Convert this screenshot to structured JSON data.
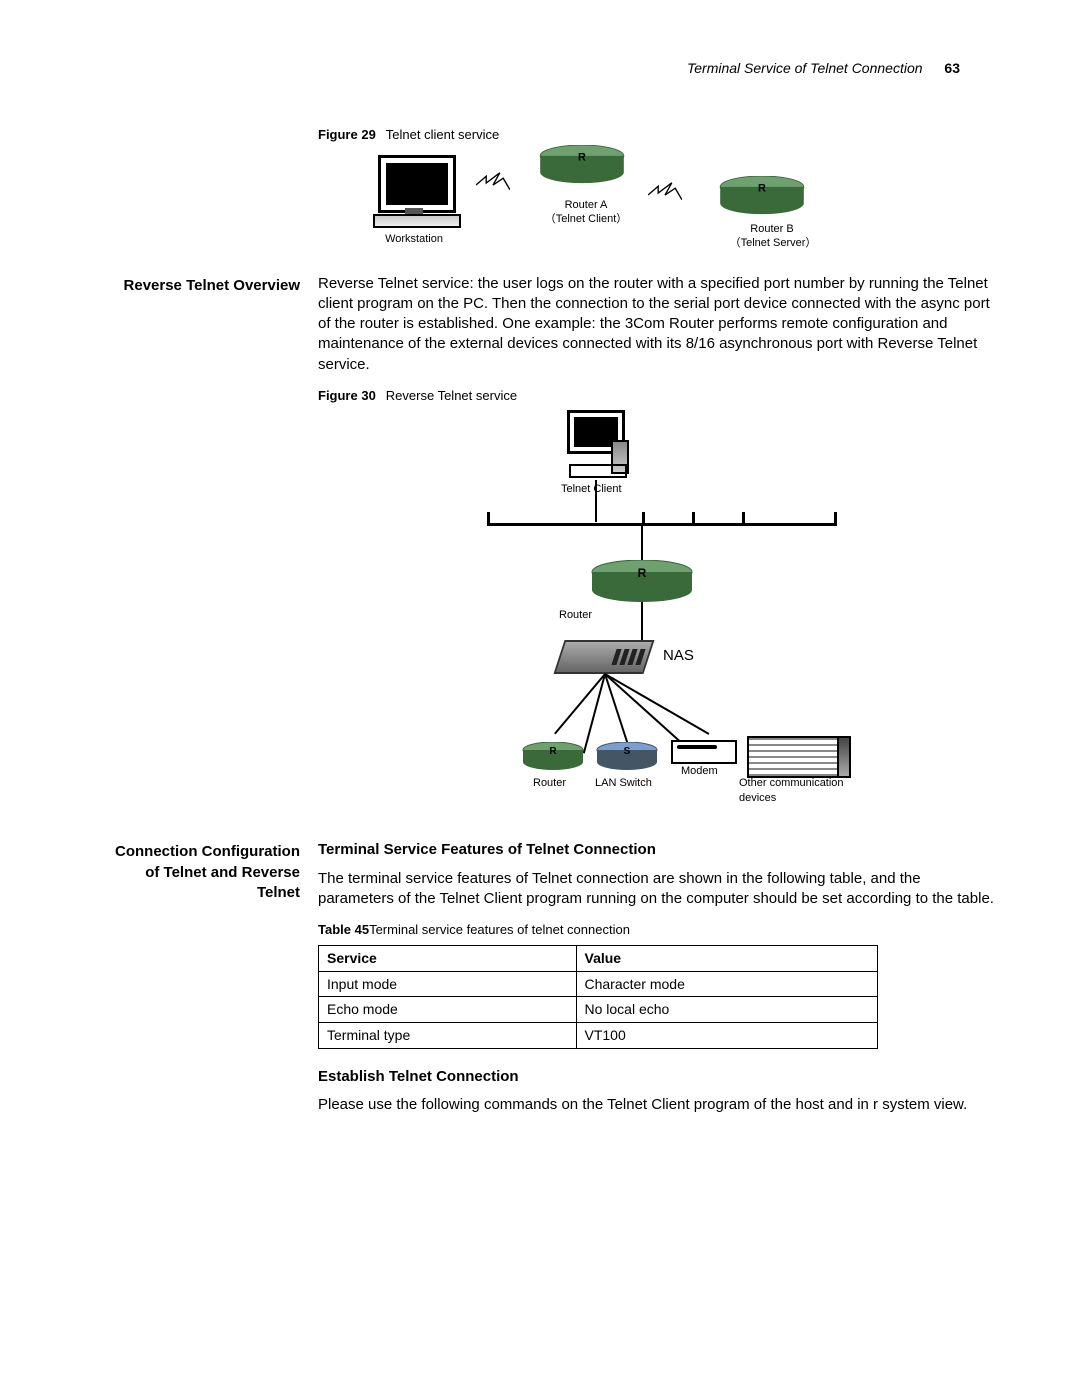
{
  "header": {
    "running": "Terminal Service of Telnet Connection",
    "page": "63"
  },
  "figure29": {
    "label": "Figure 29",
    "title": "Telnet client service",
    "workstation": "Workstation",
    "routerA": "Router A",
    "routerA_sub": "（Telnet Client）",
    "routerB": "Router B",
    "routerB_sub": "（Telnet Server）"
  },
  "section_reverse_label": "Reverse Telnet Overview",
  "reverse_overview_para": "Reverse Telnet service: the user logs on the router with a specified port number by running the Telnet client program on the PC. Then the connection to the serial port device connected with the async port of the router is established. One example: the 3Com Router performs remote configuration and maintenance of the external devices connected with its 8/16 asynchronous port with Reverse Telnet service.",
  "figure30": {
    "label": "Figure 30",
    "title": "Reverse Telnet service",
    "telnet_client": "Telnet Client",
    "router": "Router",
    "nas": "NAS",
    "small_router": "Router",
    "lan_switch": "LAN Switch",
    "modem": "Modem",
    "other": "Other communication devices"
  },
  "section_conn_label": "Connection Configuration of Telnet and Reverse Telnet",
  "subhead_features": "Terminal Service Features of Telnet Connection",
  "features_para": "The terminal service features of Telnet connection are shown in the following table, and the parameters of the Telnet Client program running on the computer should be set according to the table.",
  "table45": {
    "label": "Table 45",
    "title": "Terminal service features of telnet connection",
    "head_service": "Service",
    "head_value": "Value",
    "rows": [
      {
        "service": "Input mode",
        "value": "Character mode"
      },
      {
        "service": "Echo mode",
        "value": "No local echo"
      },
      {
        "service": "Terminal type",
        "value": "VT100"
      }
    ]
  },
  "subhead_establish": "Establish Telnet Connection",
  "establish_para": "Please use the following commands on the Telnet Client program of the host and in r system view."
}
